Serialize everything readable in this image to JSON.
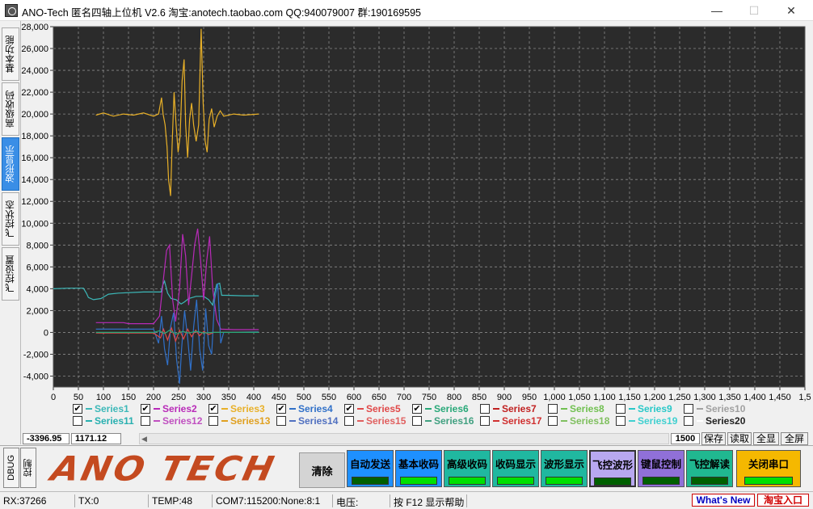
{
  "window": {
    "title": "ANO-Tech   匿名四轴上位机   V2.6   淘宝:anotech.taobao.com   QQ:940079007   群:190169595",
    "minimize": "—",
    "maximize": "☐",
    "close": "✕"
  },
  "left_tabs": [
    "基本功能",
    "高级收码",
    "波形显示",
    "飞控状态",
    "飞控设置"
  ],
  "chart_data": {
    "type": "line",
    "background": "#2b2b2b",
    "grid": true,
    "xlim": [
      0,
      1500
    ],
    "ylim": [
      -5000,
      28000
    ],
    "x_ticks": [
      "0",
      "50",
      "100",
      "150",
      "200",
      "250",
      "300",
      "350",
      "400",
      "450",
      "500",
      "550",
      "600",
      "650",
      "700",
      "750",
      "800",
      "850",
      "900",
      "950",
      "1,000",
      "1,050",
      "1,100",
      "1,150",
      "1,200",
      "1,250",
      "1,300",
      "1,350",
      "1,400",
      "1,450",
      "1,5"
    ],
    "y_ticks": [
      "28,000",
      "26,000",
      "24,000",
      "22,000",
      "20,000",
      "18,000",
      "16,000",
      "14,000",
      "12,000",
      "10,000",
      "8,000",
      "6,000",
      "4,000",
      "2,000",
      "0",
      "-2,000",
      "-4,000"
    ],
    "series": [
      {
        "name": "Series1",
        "color": "#3cb8b8",
        "checked": true,
        "points": [
          [
            0,
            4000
          ],
          [
            30,
            4050
          ],
          [
            60,
            4050
          ],
          [
            66,
            3600
          ],
          [
            70,
            3200
          ],
          [
            80,
            3000
          ],
          [
            95,
            3100
          ],
          [
            110,
            3500
          ],
          [
            130,
            3600
          ],
          [
            180,
            3700
          ],
          [
            215,
            3700
          ],
          [
            218,
            4300
          ],
          [
            222,
            4700
          ],
          [
            228,
            3600
          ],
          [
            235,
            3100
          ],
          [
            245,
            3000
          ],
          [
            255,
            2600
          ],
          [
            262,
            2800
          ],
          [
            270,
            3100
          ],
          [
            285,
            3300
          ],
          [
            300,
            3300
          ],
          [
            310,
            3000
          ],
          [
            318,
            2500
          ],
          [
            322,
            3600
          ],
          [
            326,
            4400
          ],
          [
            332,
            4500
          ],
          [
            336,
            3400
          ],
          [
            345,
            3400
          ],
          [
            380,
            3350
          ],
          [
            410,
            3350
          ]
        ]
      },
      {
        "name": "Series2",
        "color": "#b82ab8",
        "checked": true,
        "points": [
          [
            85,
            900
          ],
          [
            140,
            900
          ],
          [
            150,
            800
          ],
          [
            200,
            800
          ],
          [
            212,
            1500
          ],
          [
            220,
            5000
          ],
          [
            226,
            7500
          ],
          [
            232,
            8000
          ],
          [
            238,
            3000
          ],
          [
            244,
            1000
          ],
          [
            252,
            4000
          ],
          [
            258,
            9000
          ],
          [
            264,
            7000
          ],
          [
            270,
            2500
          ],
          [
            276,
            5200
          ],
          [
            282,
            8000
          ],
          [
            288,
            9500
          ],
          [
            294,
            6500
          ],
          [
            300,
            3000
          ],
          [
            306,
            6500
          ],
          [
            312,
            8800
          ],
          [
            318,
            4000
          ],
          [
            326,
            1200
          ],
          [
            334,
            300
          ],
          [
            360,
            250
          ],
          [
            410,
            250
          ]
        ]
      },
      {
        "name": "Series3",
        "color": "#e8b028",
        "checked": true,
        "points": [
          [
            85,
            19900
          ],
          [
            100,
            20100
          ],
          [
            120,
            19800
          ],
          [
            140,
            20000
          ],
          [
            160,
            19900
          ],
          [
            180,
            20100
          ],
          [
            200,
            19800
          ],
          [
            210,
            20000
          ],
          [
            216,
            21500
          ],
          [
            219,
            20000
          ],
          [
            223,
            19000
          ],
          [
            227,
            17000
          ],
          [
            230,
            14000
          ],
          [
            234,
            12500
          ],
          [
            237,
            17000
          ],
          [
            241,
            22000
          ],
          [
            245,
            19000
          ],
          [
            249,
            16500
          ],
          [
            253,
            18000
          ],
          [
            257,
            23000
          ],
          [
            261,
            25000
          ],
          [
            264,
            19000
          ],
          [
            268,
            16000
          ],
          [
            272,
            19500
          ],
          [
            276,
            21000
          ],
          [
            280,
            19000
          ],
          [
            285,
            17500
          ],
          [
            290,
            19000
          ],
          [
            295,
            27800
          ],
          [
            299,
            21000
          ],
          [
            303,
            17500
          ],
          [
            307,
            16500
          ],
          [
            311,
            19500
          ],
          [
            316,
            20500
          ],
          [
            321,
            18800
          ],
          [
            327,
            19800
          ],
          [
            333,
            20300
          ],
          [
            340,
            19800
          ],
          [
            360,
            20000
          ],
          [
            380,
            19900
          ],
          [
            410,
            20000
          ]
        ]
      },
      {
        "name": "Series4",
        "color": "#3070c8",
        "checked": true,
        "points": [
          [
            85,
            300
          ],
          [
            200,
            300
          ],
          [
            210,
            -1000
          ],
          [
            216,
            1500
          ],
          [
            222,
            -1500
          ],
          [
            228,
            -3000
          ],
          [
            234,
            500
          ],
          [
            240,
            1800
          ],
          [
            246,
            -2500
          ],
          [
            252,
            -4700
          ],
          [
            256,
            -1500
          ],
          [
            262,
            2000
          ],
          [
            268,
            -500
          ],
          [
            274,
            -3500
          ],
          [
            280,
            500
          ],
          [
            286,
            3000
          ],
          [
            292,
            -1500
          ],
          [
            298,
            -3500
          ],
          [
            304,
            2200
          ],
          [
            310,
            -1200
          ],
          [
            316,
            -2000
          ],
          [
            322,
            3000
          ],
          [
            328,
            4500
          ],
          [
            334,
            -1000
          ],
          [
            340,
            0
          ],
          [
            410,
            50
          ]
        ]
      },
      {
        "name": "Series5",
        "color": "#e04848",
        "checked": true,
        "points": [
          [
            85,
            -50
          ],
          [
            200,
            -50
          ],
          [
            214,
            -500
          ],
          [
            220,
            300
          ],
          [
            228,
            -700
          ],
          [
            236,
            400
          ],
          [
            244,
            -800
          ],
          [
            252,
            200
          ],
          [
            260,
            -600
          ],
          [
            268,
            300
          ],
          [
            276,
            -400
          ],
          [
            284,
            200
          ],
          [
            292,
            -300
          ],
          [
            300,
            100
          ],
          [
            310,
            -200
          ],
          [
            320,
            0
          ],
          [
            410,
            0
          ]
        ]
      },
      {
        "name": "Series6",
        "color": "#28a878",
        "checked": true,
        "points": [
          [
            85,
            0
          ],
          [
            200,
            0
          ],
          [
            212,
            150
          ],
          [
            222,
            -100
          ],
          [
            232,
            200
          ],
          [
            245,
            -150
          ],
          [
            258,
            100
          ],
          [
            270,
            -50
          ],
          [
            285,
            100
          ],
          [
            300,
            -50
          ],
          [
            320,
            0
          ],
          [
            410,
            0
          ]
        ]
      },
      {
        "name": "Series7",
        "color": "#c02020",
        "checked": false
      },
      {
        "name": "Series8",
        "color": "#70c050",
        "checked": false
      },
      {
        "name": "Series9",
        "color": "#28c8c8",
        "checked": false
      },
      {
        "name": "Series10",
        "color": "#a0a0a0",
        "checked": false
      },
      {
        "name": "Series11",
        "color": "#28b0b0",
        "checked": false
      },
      {
        "name": "Series12",
        "color": "#c050c0",
        "checked": false
      },
      {
        "name": "Series13",
        "color": "#e0a020",
        "checked": false
      },
      {
        "name": "Series14",
        "color": "#5070c0",
        "checked": false
      },
      {
        "name": "Series15",
        "color": "#e06060",
        "checked": false
      },
      {
        "name": "Series16",
        "color": "#40a080",
        "checked": false
      },
      {
        "name": "Series17",
        "color": "#d03030",
        "checked": false
      },
      {
        "name": "Series18",
        "color": "#80c060",
        "checked": false
      },
      {
        "name": "Series19",
        "color": "#40d0d0",
        "checked": false
      },
      {
        "name": "Series20",
        "color": "#ffffff",
        "checked": false
      }
    ]
  },
  "coord": {
    "x": "-3396.95",
    "y": "1171.12"
  },
  "scroll_controls": {
    "count": "1500",
    "save": "保存",
    "read": "读取",
    "show_all": "全显",
    "fullscreen": "全屏"
  },
  "bottom": {
    "tab_debug": "DBUG",
    "tab_control": "控制",
    "logo": "ANO TECH",
    "clear": "清除",
    "buttons": [
      {
        "label": "自动发送",
        "bg": "#1e90ff",
        "indicator": "#006000"
      },
      {
        "label": "基本收码",
        "bg": "#1e90ff",
        "indicator": "#00e000"
      },
      {
        "label": "高级收码",
        "bg": "#20b8a0",
        "indicator": "#00e000"
      },
      {
        "label": "收码显示",
        "bg": "#20b8a0",
        "indicator": "#00e000"
      },
      {
        "label": "波形显示",
        "bg": "#20b8a0",
        "indicator": "#00e000"
      },
      {
        "label": "飞控波形",
        "bg": "#b8a8f0",
        "indicator": "#006000"
      },
      {
        "label": "键鼠控制",
        "bg": "#9070d8",
        "indicator": "#006000"
      },
      {
        "label": "飞控解读",
        "bg": "#20b890",
        "indicator": "#006000"
      },
      {
        "label": "关闭串口",
        "bg": "#f5b800",
        "indicator": "#00e000"
      }
    ]
  },
  "status": {
    "rx": "RX:37266",
    "tx": "TX:0",
    "temp": "TEMP:48",
    "port": "COM7:115200:None:8:1",
    "voltage": "电压:",
    "help": "按 F12 显示帮助",
    "whats_new": "What's New",
    "taobao": "淘宝入口"
  }
}
